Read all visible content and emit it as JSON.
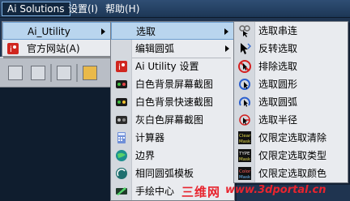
{
  "menubar": {
    "items": [
      "Ai Solutions",
      "设置(I)",
      "帮助(H)"
    ]
  },
  "menu_l1": {
    "items": [
      {
        "label": "Ai_Utility",
        "icon": "none",
        "submenu": true
      },
      {
        "label": "官方网站(A)",
        "icon": "ai-logo-icon",
        "submenu": false
      }
    ]
  },
  "menu_l2": {
    "items": [
      {
        "label": "选取",
        "icon": "none",
        "submenu": true
      },
      {
        "label": "编辑圆弧",
        "icon": "none",
        "submenu": true
      },
      {
        "label": "Ai Utility 设置",
        "icon": "ai-logo-icon"
      },
      {
        "label": "白色背景屏幕截图",
        "icon": "screenshot-color-icon"
      },
      {
        "label": "白色背景快速截图",
        "icon": "screenshot-quick-icon"
      },
      {
        "label": "灰白色屏幕截图",
        "icon": "screenshot-gray-icon"
      },
      {
        "label": "计算器",
        "icon": "calculator-icon"
      },
      {
        "label": "边界",
        "icon": "globe-icon"
      },
      {
        "label": "相同圆弧模板",
        "icon": "arc-template-icon"
      },
      {
        "label": "手绘中心",
        "icon": "green-pen-icon"
      }
    ]
  },
  "menu_l3": {
    "items": [
      {
        "label": "选取串连",
        "icon": "chain-select-icon"
      },
      {
        "label": "反转选取",
        "icon": "reverse-select-icon"
      },
      {
        "label": "排除选取",
        "icon": "exclude-select-icon"
      },
      {
        "label": "选取圆形",
        "icon": "circle-select-icon"
      },
      {
        "label": "选取圆弧",
        "icon": "arc-select-icon"
      },
      {
        "label": "选取半径",
        "icon": "radius-select-icon"
      },
      {
        "label": "仅限定选取清除",
        "icon": "clear-mask-icon",
        "badge": "Clear Mask"
      },
      {
        "label": "仅限定选取类型",
        "icon": "type-mask-icon",
        "badge": "TYPE Mask"
      },
      {
        "label": "仅限定选取颜色",
        "icon": "color-mask-icon",
        "badge": "Color Mask"
      }
    ]
  },
  "watermark": {
    "cn": "三维网",
    "url": "www.3dportal.cn"
  },
  "colors": {
    "menubar": "#1d3756",
    "menu_bg": "#e9ebef",
    "highlight": "#b9d5ee",
    "watermark": "#e8242e"
  }
}
